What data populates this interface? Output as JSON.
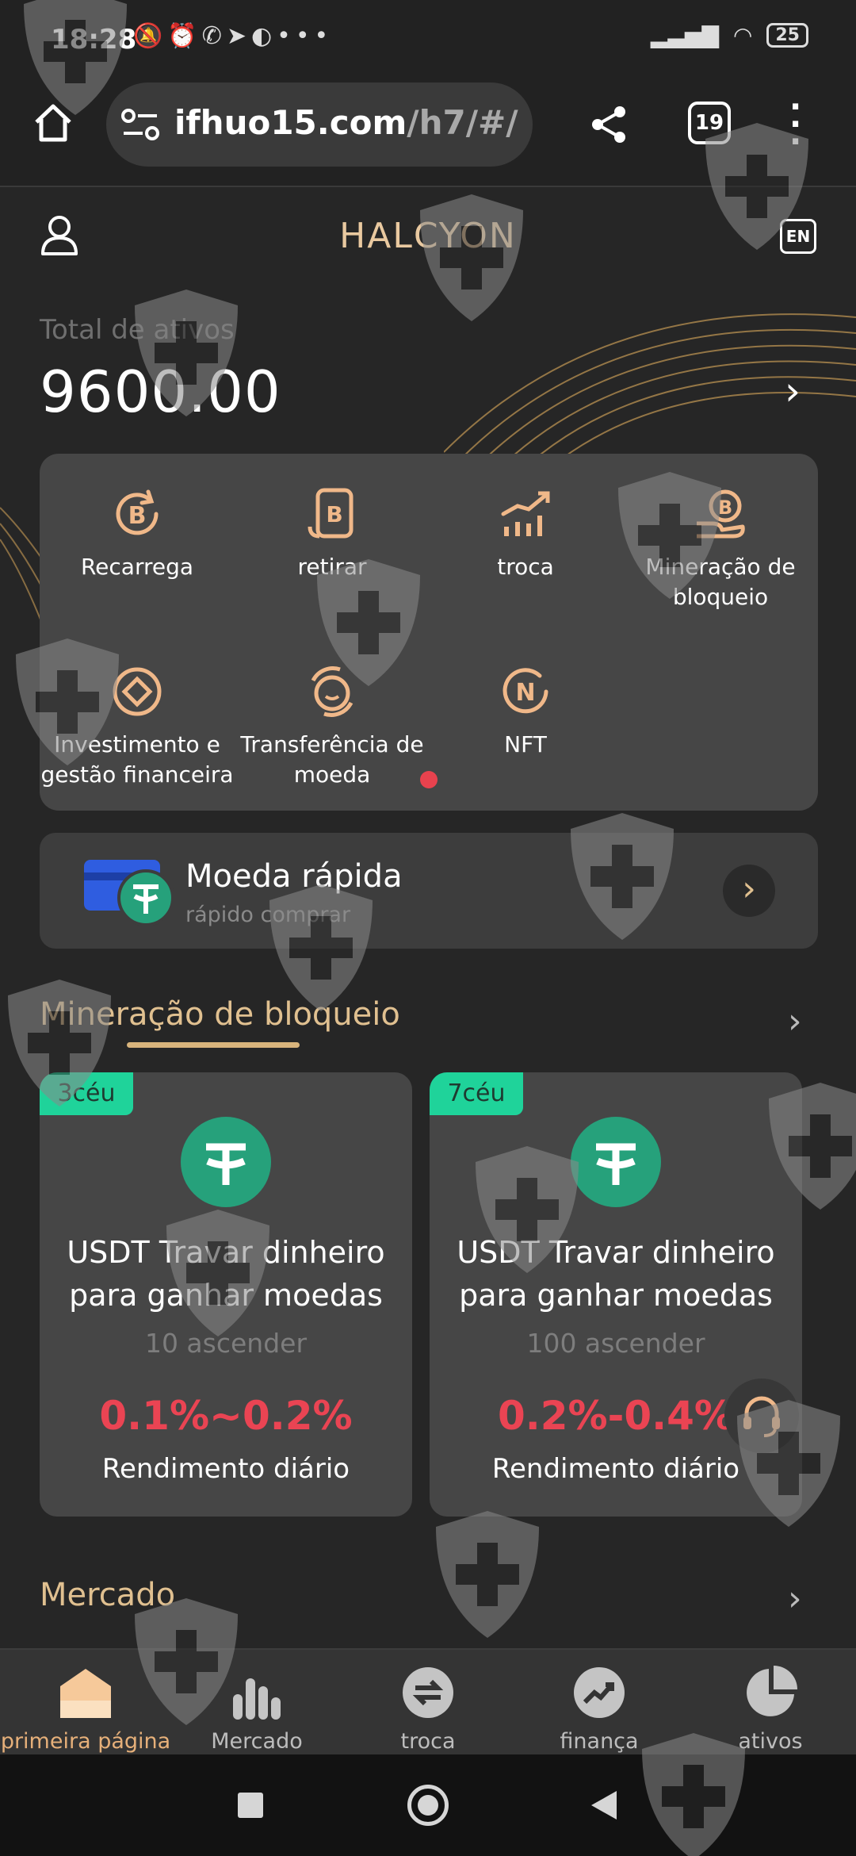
{
  "status_bar": {
    "time": "18:28",
    "battery": "25"
  },
  "browser": {
    "url_domain": "ifhuo15.com",
    "url_path": "/h7/#/",
    "tab_count": "19"
  },
  "header": {
    "title": "HALCYON",
    "lang_badge": "EN"
  },
  "assets": {
    "label": "Total de ativos",
    "value": "9600.00"
  },
  "features": [
    {
      "label": "Recarrega",
      "icon": "bitcoin-refresh-icon"
    },
    {
      "label": "retirar",
      "icon": "bitcoin-wallet-icon"
    },
    {
      "label": "troca",
      "icon": "trend-chart-icon"
    },
    {
      "label": "Mineração de bloqueio",
      "icon": "bitcoin-hand-icon"
    },
    {
      "label": "Investimento e gestão financeira",
      "icon": "diamond-coin-icon"
    },
    {
      "label": "Transferência de moeda",
      "icon": "coin-exchange-icon"
    },
    {
      "label": "NFT",
      "icon": "nft-coin-icon"
    }
  ],
  "quick": {
    "title": "Moeda rápida",
    "subtitle": "rápido comprar"
  },
  "mining": {
    "title": "Mineração de bloqueio",
    "cards": [
      {
        "tag": "3céu",
        "name": "USDT Travar dinheiro para ganhar moedas",
        "level": "10 ascender",
        "rate": "0.1%~0.2%",
        "rate_label": "Rendimento diário"
      },
      {
        "tag": "7céu",
        "name": "USDT Travar dinheiro para ganhar moedas",
        "level": "100 ascender",
        "rate": "0.2%-0.4%",
        "rate_label": "Rendimento diário"
      }
    ]
  },
  "market": {
    "title": "Mercado"
  },
  "tabbar": [
    {
      "label": "primeira página",
      "icon": "home-icon",
      "active": true
    },
    {
      "label": "Mercado",
      "icon": "bars-icon",
      "active": false
    },
    {
      "label": "troca",
      "icon": "swap-icon",
      "active": false
    },
    {
      "label": "finança",
      "icon": "trend-icon",
      "active": false
    },
    {
      "label": "ativos",
      "icon": "pie-icon",
      "active": false
    }
  ],
  "colors": {
    "accent": "#e6b07a",
    "gold_text": "#e0c090",
    "rate_red": "#ea4453",
    "tag_green": "#1fd39a",
    "tether_green": "#26a17b"
  }
}
